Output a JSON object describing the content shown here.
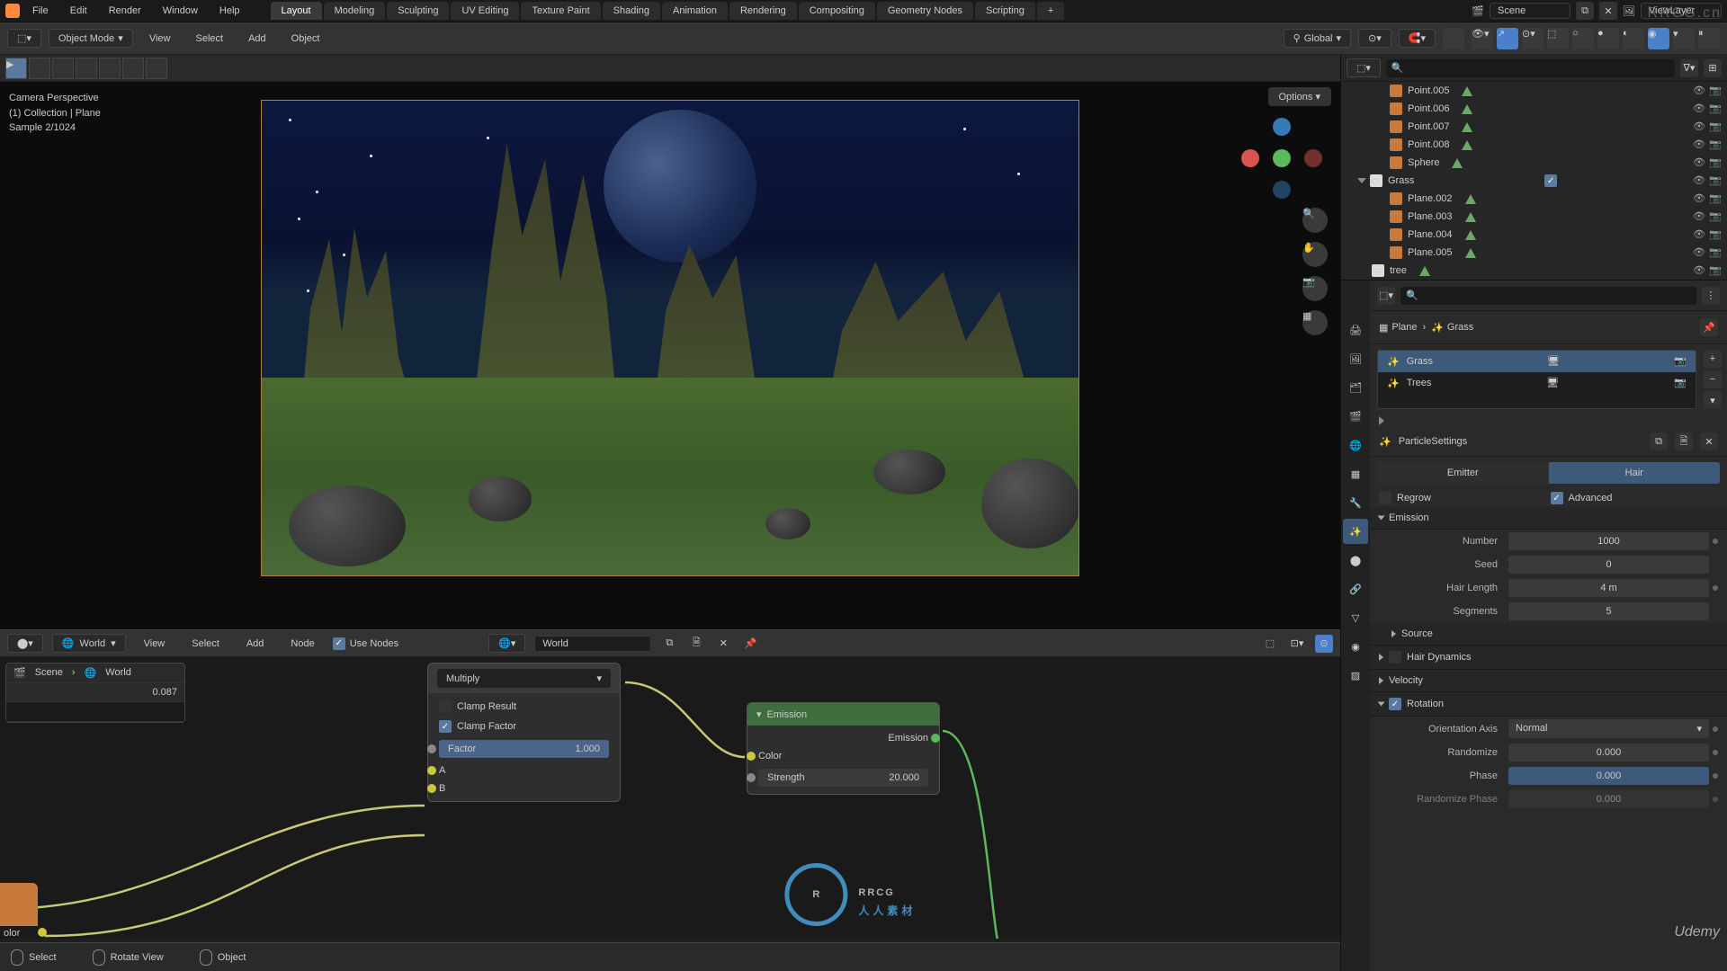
{
  "topMenu": [
    "File",
    "Edit",
    "Render",
    "Window",
    "Help"
  ],
  "workspaces": [
    "Layout",
    "Modeling",
    "Sculpting",
    "UV Editing",
    "Texture Paint",
    "Shading",
    "Animation",
    "Rendering",
    "Compositing",
    "Geometry Nodes",
    "Scripting"
  ],
  "activeWorkspace": "Layout",
  "sceneField": "Scene",
  "viewLayerField": "ViewLayer",
  "cornerWatermark": "RRCG.cn",
  "objectModeMenu": [
    "View",
    "Select",
    "Add",
    "Object"
  ],
  "objectMode": "Object Mode",
  "orientation": "Global",
  "viewportOverlay": {
    "line1": "Camera Perspective",
    "line2": "(1) Collection | Plane",
    "line3": "Sample 2/1024"
  },
  "optionsLabel": "Options",
  "nodeEditor": {
    "menus": [
      "View",
      "Select",
      "Add",
      "Node"
    ],
    "useNodes": "Use Nodes",
    "world": "World",
    "treeScene": "Scene",
    "treeWorld": "World",
    "treeVal": "0.087",
    "mix": {
      "mode": "Multiply",
      "clampResult": "Clamp Result",
      "clampFactor": "Clamp Factor",
      "factorLabel": "Factor",
      "factorVal": "1.000",
      "a": "A",
      "b": "B"
    },
    "emission": {
      "title": "Emission",
      "outLabel": "Emission",
      "color": "Color",
      "strengthLabel": "Strength",
      "strengthVal": "20.000"
    }
  },
  "statusBar": {
    "select": "Select",
    "rotate": "Rotate View",
    "object": "Object"
  },
  "outliner": {
    "items": [
      {
        "indent": 2,
        "type": "mesh",
        "name": "Point.005",
        "mat": true
      },
      {
        "indent": 2,
        "type": "mesh",
        "name": "Point.006",
        "mat": true
      },
      {
        "indent": 2,
        "type": "mesh",
        "name": "Point.007",
        "mat": true
      },
      {
        "indent": 2,
        "type": "mesh",
        "name": "Point.008",
        "mat": true
      },
      {
        "indent": 2,
        "type": "mesh",
        "name": "Sphere",
        "mat": true
      },
      {
        "indent": 1,
        "type": "coll",
        "name": "Grass",
        "expand": true,
        "check": true
      },
      {
        "indent": 2,
        "type": "mesh",
        "name": "Plane.002",
        "mat": true
      },
      {
        "indent": 2,
        "type": "mesh",
        "name": "Plane.003",
        "mat": true
      },
      {
        "indent": 2,
        "type": "mesh",
        "name": "Plane.004",
        "mat": true
      },
      {
        "indent": 2,
        "type": "mesh",
        "name": "Plane.005",
        "mat": true
      },
      {
        "indent": 1,
        "type": "coll",
        "name": "tree",
        "mat": true
      }
    ]
  },
  "breadcrumb": {
    "obj": "Plane",
    "ps": "Grass"
  },
  "particleList": [
    {
      "name": "Grass",
      "sel": true
    },
    {
      "name": "Trees",
      "sel": false
    }
  ],
  "particleSettings": "ParticleSettings",
  "typeButtons": {
    "emitter": "Emitter",
    "hair": "Hair"
  },
  "regrow": "Regrow",
  "advanced": "Advanced",
  "panels": {
    "emission": "Emission",
    "source": "Source",
    "hairDynamics": "Hair Dynamics",
    "velocity": "Velocity",
    "rotation": "Rotation"
  },
  "emission": {
    "numberL": "Number",
    "numberV": "1000",
    "seedL": "Seed",
    "seedV": "0",
    "hairL": "Hair Length",
    "hairV": "4 m",
    "segL": "Segments",
    "segV": "5"
  },
  "rotation": {
    "axisL": "Orientation Axis",
    "axisV": "Normal",
    "randL": "Randomize",
    "randV": "0.000",
    "phaseL": "Phase",
    "phaseV": "0.000",
    "rphaseL": "Randomize Phase",
    "rphaseV": "0.000"
  },
  "watermark": {
    "logo": "R",
    "main": "RRCG",
    "sub": "人人素材"
  },
  "udemy": "Udemy"
}
